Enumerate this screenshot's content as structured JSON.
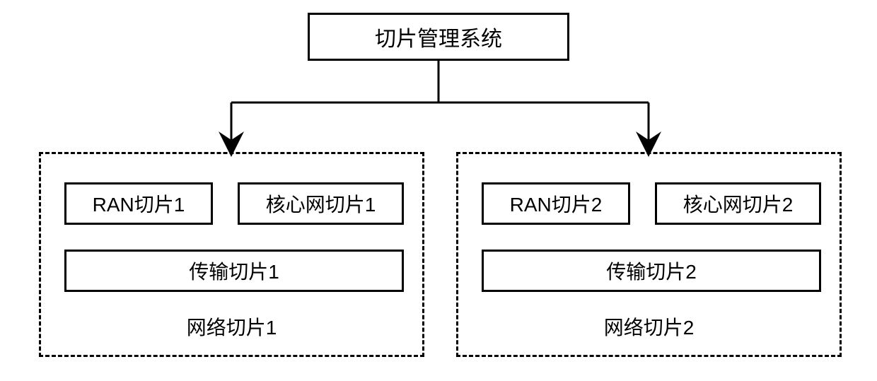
{
  "manager": {
    "title": "切片管理系统"
  },
  "slices": [
    {
      "ran": "RAN切片1",
      "core": "核心网切片1",
      "transport": "传输切片1",
      "label": "网络切片1"
    },
    {
      "ran": "RAN切片2",
      "core": "核心网切片2",
      "transport": "传输切片2",
      "label": "网络切片2"
    }
  ]
}
